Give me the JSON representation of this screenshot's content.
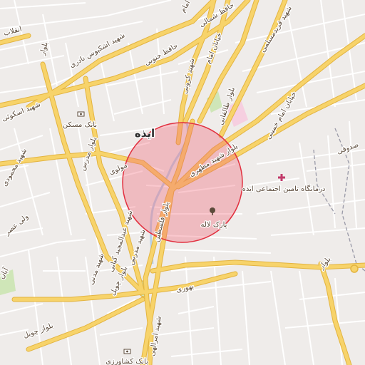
{
  "map": {
    "city_label": "ایذه",
    "colors": {
      "background": "#efecea",
      "minor_road": "#ffffff",
      "major_road": "#f7d36a",
      "major_road_casing": "#e3b440",
      "river": "#b8d0e8",
      "park": "#cfe6b8",
      "hospital_area": "#f6cfe0",
      "highlight_fill": "#f06272",
      "highlight_stroke": "#e2303f",
      "admin_border": "#9a9aa8"
    },
    "road_labels": [
      "حافظ شمالی",
      "شهید اشکبوس نادری",
      "حافظ جنوبی",
      "امام",
      "خیابان امام",
      "شهید فریدمسلمی",
      "شهید کرونی",
      "بلوار طالقانی",
      "خیابان امام خمینی",
      "بلوار شهید مطهری",
      "شهید اسکوئی",
      "بلوار مدرس",
      "مولوی",
      "بلوار فلسطین",
      "شهید عبدالمجید کیانی",
      "صدوقی",
      "شهید محمودی",
      "ولی عصر",
      "شهید مدرس",
      "شهید مدنی",
      "بلوار چوبل",
      "بهوری",
      "بلوار",
      "آبان",
      "بلوار چوبل",
      "شهید امرالهی",
      "بلوار",
      "انقلاب"
    ],
    "pois": {
      "bank_maskan": "بانک مسکن",
      "clinic": "درمانگاه تامین اجتماعی ایذه",
      "park": "پارک لاله",
      "bank_keshavarzi": "بانک کشاورزی"
    },
    "icons": [
      "bank-icon",
      "clinic-cross-icon",
      "park-tree-icon",
      "bank-icon"
    ]
  }
}
